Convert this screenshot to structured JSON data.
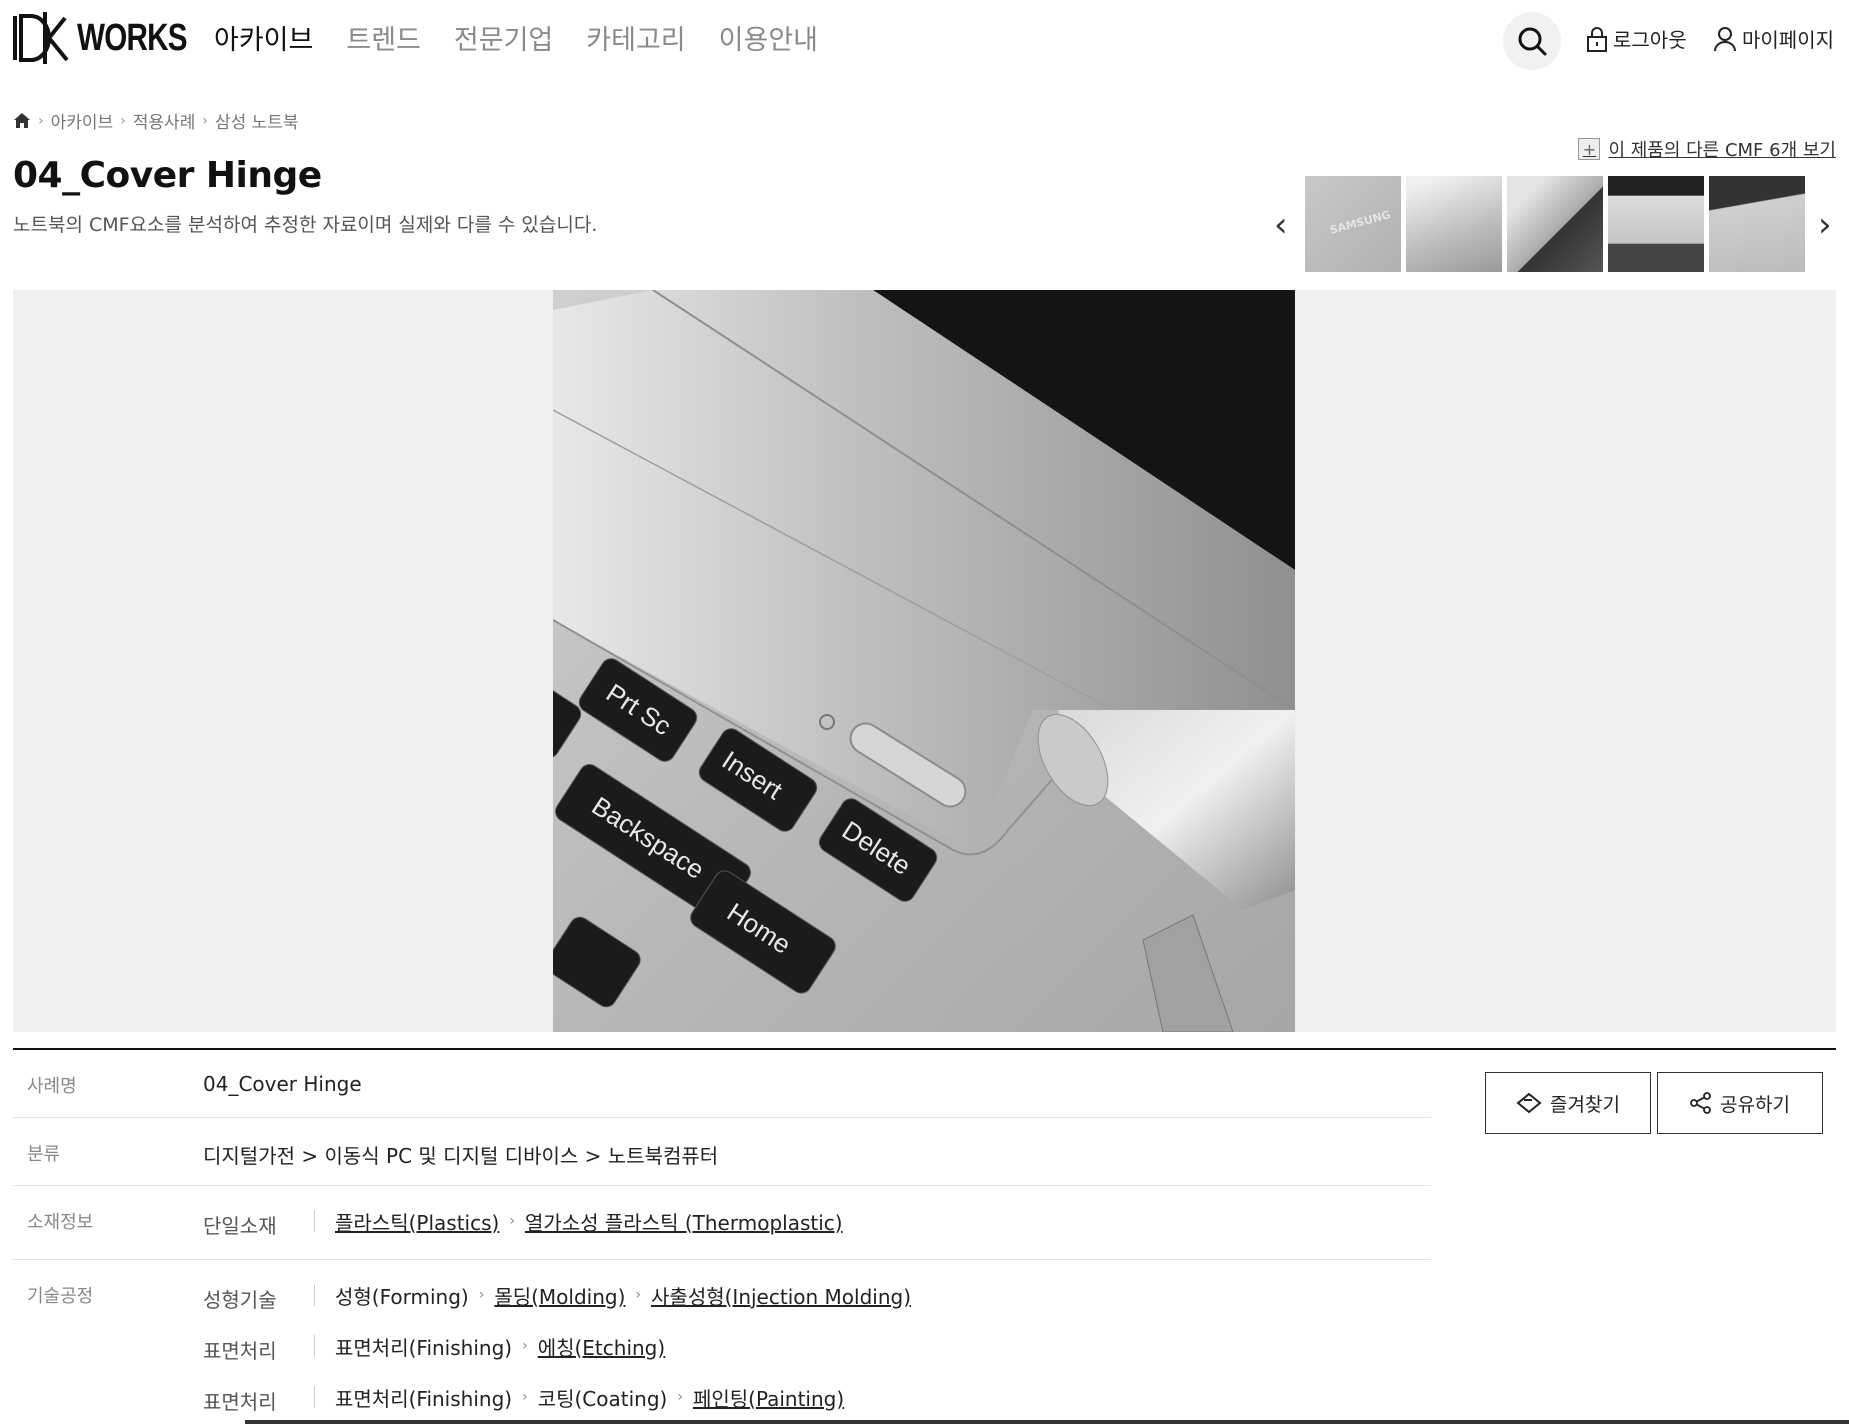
{
  "header": {
    "logo_text": "WORKS",
    "nav": [
      {
        "label": "아카이브",
        "active": true
      },
      {
        "label": "트렌드",
        "active": false
      },
      {
        "label": "전문기업",
        "active": false
      },
      {
        "label": "카테고리",
        "active": false
      },
      {
        "label": "이용안내",
        "active": false
      }
    ],
    "search_icon": "search-icon",
    "logout_label": "로그아웃",
    "mypage_label": "마이페이지"
  },
  "breadcrumb": {
    "home_icon": "home-icon",
    "items": [
      "아카이브",
      "적용사례",
      "삼성 노트북"
    ]
  },
  "title": "04_Cover Hinge",
  "description": "노트북의 CMF요소를 분석하여 추정한 자료이며 실제와 다를 수 있습니다.",
  "thumbnails": {
    "other_link": "이 제품의 다른 CMF 6개 보기",
    "thumb1_text": "SAMSUNG",
    "prev": "‹",
    "next": "›"
  },
  "photo": {
    "keys": [
      "Prt Sc",
      "Insert",
      "Delete",
      "Backspace",
      "Home"
    ]
  },
  "info": {
    "case_name_label": "사례명",
    "case_name": "04_Cover Hinge",
    "category_label": "분류",
    "category": "디지털가전 > 이동식 PC 및 디지털 디바이스 > 노트북컴퓨터",
    "material_label": "소재정보",
    "material_sub": "단일소재",
    "material_path": [
      "플라스틱(Plastics)",
      "열가소성 플라스틱 (Thermoplastic)"
    ],
    "process_label": "기술공정",
    "processes": [
      {
        "sub": "성형기술",
        "path": [
          "성형(Forming)",
          "몰딩(Molding)",
          "사출성형(Injection Molding)"
        ]
      },
      {
        "sub": "표면처리",
        "path": [
          "표면처리(Finishing)",
          "에칭(Etching)"
        ]
      },
      {
        "sub": "표면처리",
        "path": [
          "표면처리(Finishing)",
          "코팅(Coating)",
          "페인팅(Painting)"
        ]
      }
    ]
  },
  "actions": {
    "favorite_label": "즐겨찾기",
    "share_label": "공유하기"
  }
}
